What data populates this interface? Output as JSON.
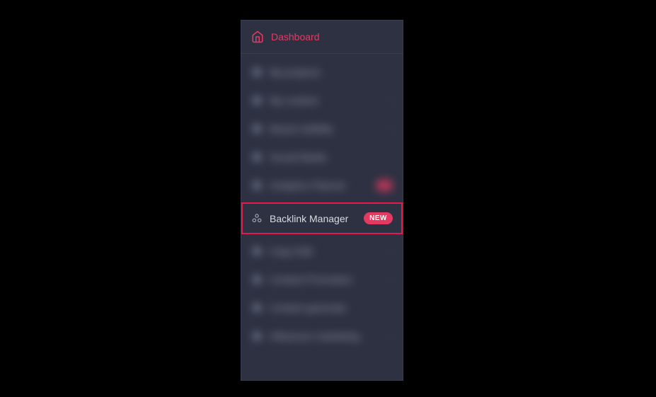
{
  "dashboard": {
    "label": "Dashboard"
  },
  "nav": {
    "blurred_before": [
      {
        "label": "My projects",
        "has_caret": false,
        "has_badge": false
      },
      {
        "label": "My content",
        "has_caret": true,
        "has_badge": false
      },
      {
        "label": "Brand visibility",
        "has_caret": true,
        "has_badge": false
      },
      {
        "label": "Social Media",
        "has_caret": false,
        "has_badge": false
      },
      {
        "label": "Analytics Planner",
        "has_caret": false,
        "has_badge": true
      }
    ],
    "highlighted": {
      "label": "Backlink Manager",
      "badge": "NEW"
    },
    "blurred_after": [
      {
        "label": "Copy Edit",
        "has_caret": true,
        "has_badge": false
      },
      {
        "label": "Content Promotion",
        "has_caret": true,
        "has_badge": false
      },
      {
        "label": "Content generate",
        "has_caret": false,
        "has_badge": false
      },
      {
        "label": "Influencer marketing",
        "has_caret": true,
        "has_badge": false
      }
    ]
  }
}
